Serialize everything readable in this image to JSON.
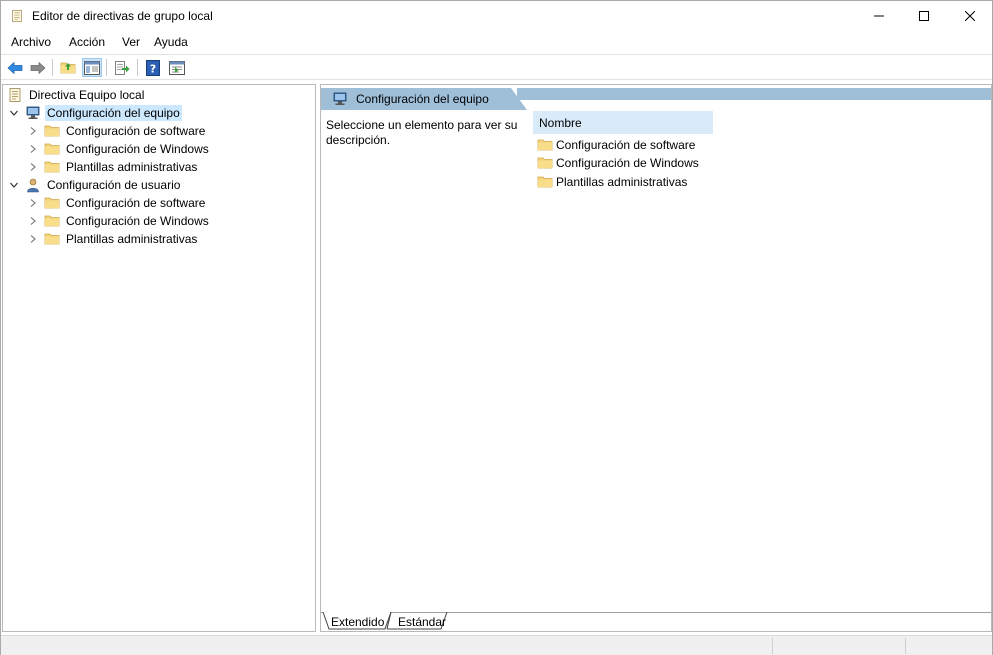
{
  "window": {
    "title": "Editor de directivas de grupo local"
  },
  "menu": [
    "Archivo",
    "Acción",
    "Ver",
    "Ayuda"
  ],
  "toolbar": {
    "buttons": [
      "back-icon",
      "forward-icon",
      "up-folder-icon",
      "show-hide-tree-icon",
      "export-list-icon",
      "help-icon",
      "properties-icon"
    ]
  },
  "tree": {
    "root": "Directiva Equipo local",
    "computer": {
      "label": "Configuración del equipo",
      "children": [
        "Configuración de software",
        "Configuración de Windows",
        "Plantillas administrativas"
      ]
    },
    "user": {
      "label": "Configuración de usuario",
      "children": [
        "Configuración de software",
        "Configuración de Windows",
        "Plantillas administrativas"
      ]
    }
  },
  "detail": {
    "header": "Configuración del equipo",
    "description": "Seleccione un elemento para ver su descripción.",
    "column_name": "Nombre",
    "items": [
      "Configuración de software",
      "Configuración de Windows",
      "Plantillas administrativas"
    ]
  },
  "view_tabs": [
    "Extendido",
    "Estándar"
  ],
  "colors": {
    "selection": "#cce8ff",
    "header_band": "#9fbfd9",
    "column_header": "#d9ebf9",
    "folder": "#f3d37a"
  }
}
